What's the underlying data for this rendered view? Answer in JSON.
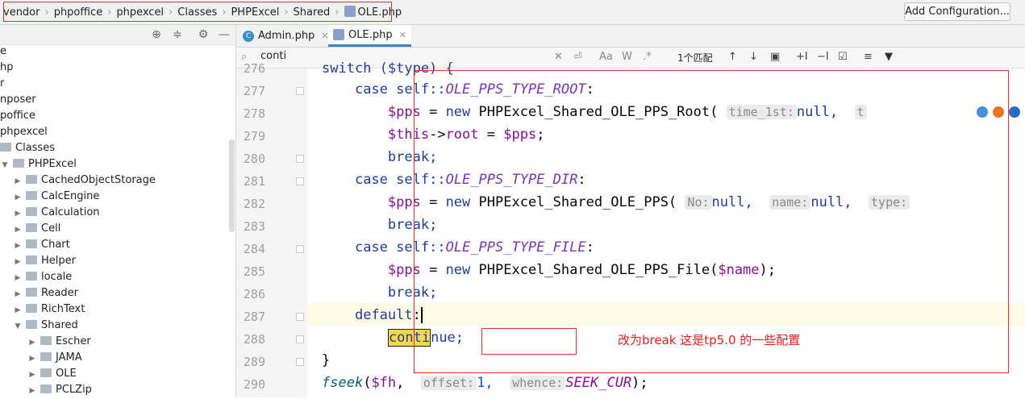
{
  "breadcrumb": [
    "vendor",
    "phpoffice",
    "phpexcel",
    "Classes",
    "PHPExcel",
    "Shared",
    "OLE.php"
  ],
  "run_config_button": "Add Configuration...",
  "tree": [
    {
      "label": "e",
      "depth": 0,
      "arrow": "",
      "folder": false
    },
    {
      "label": "hp",
      "depth": 0,
      "arrow": "",
      "folder": false
    },
    {
      "label": "r",
      "depth": 0,
      "arrow": "",
      "folder": false
    },
    {
      "label": "nposer",
      "depth": 0,
      "arrow": "",
      "folder": false
    },
    {
      "label": "poffice",
      "depth": 0,
      "arrow": "",
      "folder": false
    },
    {
      "label": "phpexcel",
      "depth": 0,
      "arrow": "",
      "folder": false
    },
    {
      "label": "Classes",
      "depth": 0,
      "arrow": "",
      "folder": true
    },
    {
      "label": "PHPExcel",
      "depth": 1,
      "arrow": "▼",
      "folder": true
    },
    {
      "label": "CachedObjectStorage",
      "depth": 2,
      "arrow": "▶",
      "folder": true
    },
    {
      "label": "CalcEngine",
      "depth": 2,
      "arrow": "▶",
      "folder": true
    },
    {
      "label": "Calculation",
      "depth": 2,
      "arrow": "▶",
      "folder": true
    },
    {
      "label": "Cell",
      "depth": 2,
      "arrow": "▶",
      "folder": true
    },
    {
      "label": "Chart",
      "depth": 2,
      "arrow": "▶",
      "folder": true
    },
    {
      "label": "Helper",
      "depth": 2,
      "arrow": "▶",
      "folder": true
    },
    {
      "label": "locale",
      "depth": 2,
      "arrow": "▶",
      "folder": true
    },
    {
      "label": "Reader",
      "depth": 2,
      "arrow": "▶",
      "folder": true
    },
    {
      "label": "RichText",
      "depth": 2,
      "arrow": "▶",
      "folder": true
    },
    {
      "label": "Shared",
      "depth": 2,
      "arrow": "▼",
      "folder": true
    },
    {
      "label": "Escher",
      "depth": 3,
      "arrow": "▶",
      "folder": true
    },
    {
      "label": "JAMA",
      "depth": 3,
      "arrow": "▶",
      "folder": true
    },
    {
      "label": "OLE",
      "depth": 3,
      "arrow": "▶",
      "folder": true
    },
    {
      "label": "PCLZip",
      "depth": 3,
      "arrow": "▶",
      "folder": true
    }
  ],
  "tabs": [
    {
      "label": "Admin.php",
      "icon": "class-c-icon"
    },
    {
      "label": "OLE.php",
      "icon": "php-file-icon"
    }
  ],
  "search": {
    "query": "conti",
    "match_count": "1个匹配",
    "case_option": "Aa",
    "word_option": "W",
    "regex_option": ".*"
  },
  "line_numbers": [
    "276",
    "277",
    "278",
    "279",
    "280",
    "281",
    "282",
    "283",
    "284",
    "285",
    "286",
    "287",
    "288",
    "289",
    "290"
  ],
  "code": {
    "l276": "switch ($type) {",
    "l277_kw": "case",
    "l277_self": "self::",
    "l277_const": "OLE_PPS_TYPE_ROOT",
    "l278_var": "$pps",
    "l278_new": "new",
    "l278_cls": "PHPExcel_Shared_OLE_PPS_Root(",
    "l278_hint1": "time_1st:",
    "l278_null": "null,",
    "l278_hint2": "t",
    "l279_this": "$this",
    "l279_root": "root",
    "l279_pps": "$pps",
    "break": "break;",
    "l281_const": "OLE_PPS_TYPE_DIR",
    "l282_cls": "PHPExcel_Shared_OLE_PPS(",
    "l282_hint1": "No:",
    "l282_hint2": "name:",
    "l282_hint3": "type:",
    "l284_const": "OLE_PPS_TYPE_FILE",
    "l285_cls": "PHPExcel_Shared_OLE_PPS_File(",
    "l285_name": "$name",
    "l287_default": "default",
    "l288_match": "conti",
    "l288_rest": "nue;",
    "l289": "}",
    "l290_fn": "fseek",
    "l290_fh": "$fh",
    "l290_hint1": "offset:",
    "l290_num": "1,",
    "l290_hint2": "whence:",
    "l290_const": "SEEK_CUR"
  },
  "annotation_note": "改为break  这是tp5.0 的一些配置",
  "colors": {
    "annotation": "#e02020",
    "match": "#f5d94a",
    "keyword": "#1f3e9a",
    "constant": "#7a33b5"
  }
}
